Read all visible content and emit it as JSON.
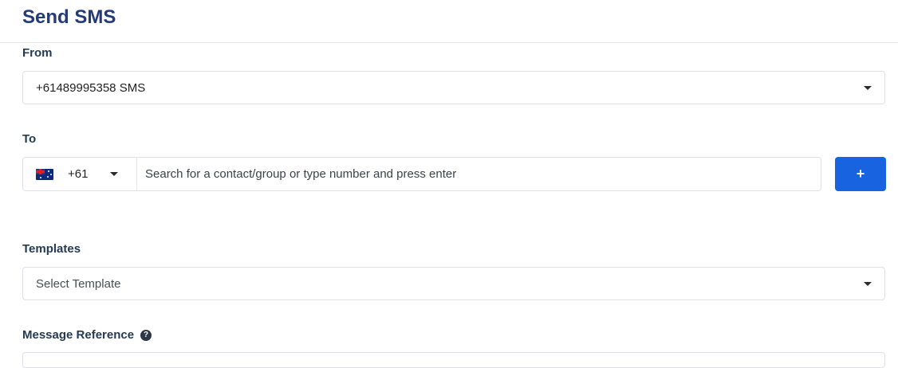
{
  "page": {
    "title": "Send SMS"
  },
  "from": {
    "label": "From",
    "selected": "+61489995358 SMS",
    "caret_icon": "chevron-down-icon"
  },
  "to": {
    "label": "To",
    "country_flag_icon": "australia-flag-icon",
    "dial_code": "+61",
    "caret_icon": "chevron-down-icon",
    "search_placeholder": "Search for a contact/group or type number and press enter",
    "search_value": "",
    "add_button_label": "+"
  },
  "templates": {
    "label": "Templates",
    "placeholder": "Select Template",
    "caret_icon": "chevron-down-icon"
  },
  "message_reference": {
    "label": "Message Reference",
    "help_icon": "question-circle-icon",
    "help_glyph": "?"
  },
  "colors": {
    "title": "#243b7a",
    "accent": "#1763e0",
    "border": "#dde1e6"
  }
}
